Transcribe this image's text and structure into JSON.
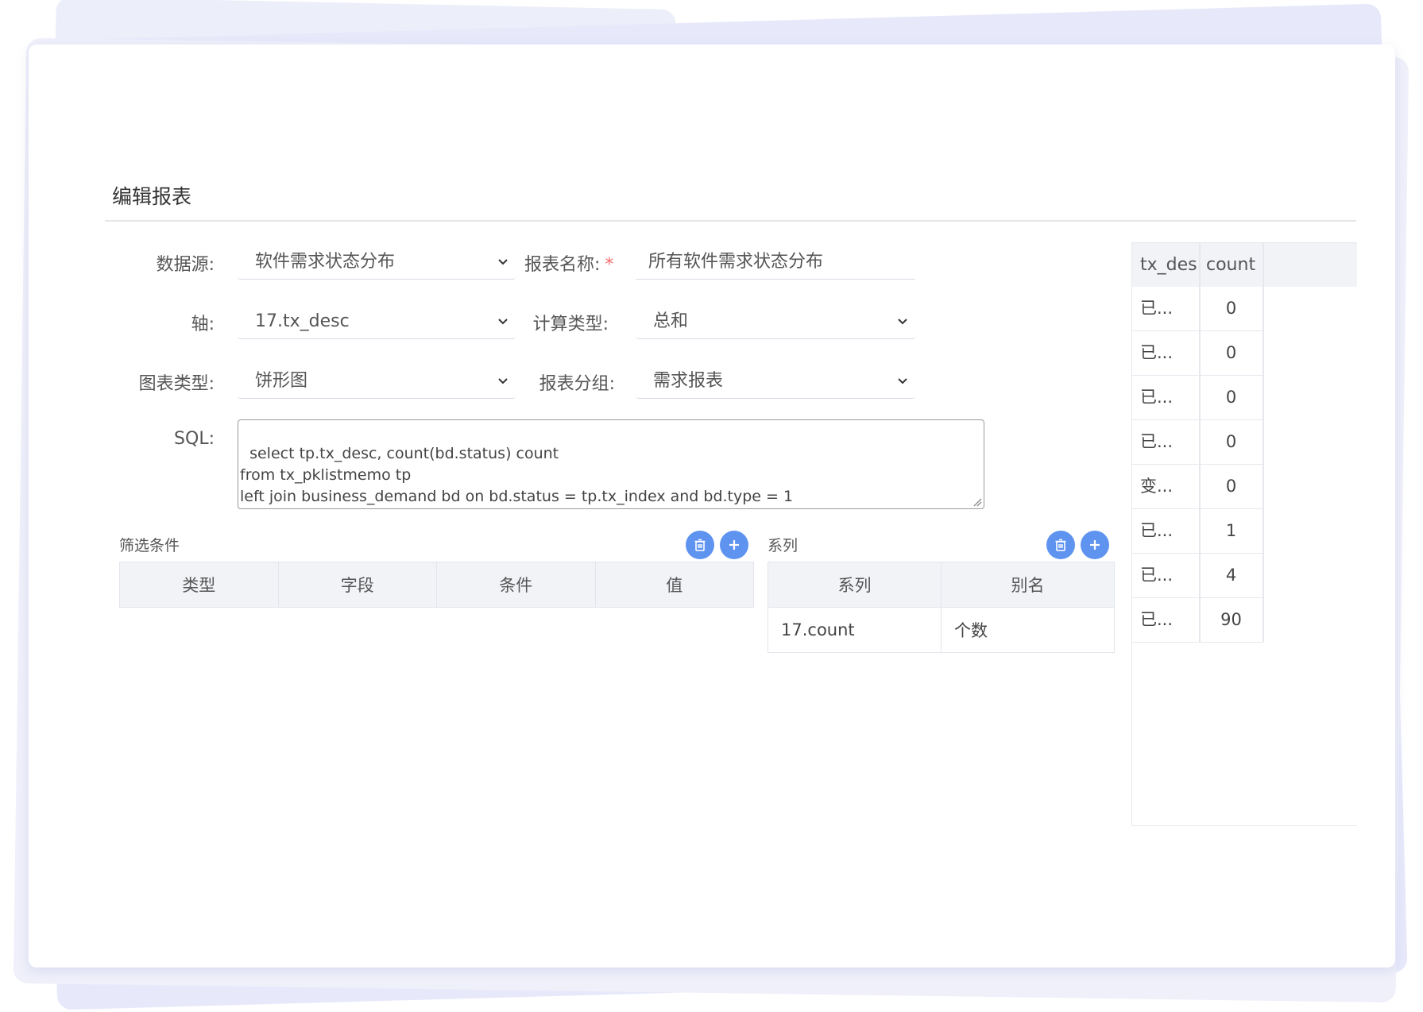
{
  "page": {
    "title": "编辑报表"
  },
  "form": {
    "datasource_label": "数据源:",
    "datasource_value": "软件需求状态分布",
    "report_name_label": "报表名称:",
    "report_name_required": "*",
    "report_name_value": "所有软件需求状态分布",
    "axis_label": "轴:",
    "axis_value": "17.tx_desc",
    "calc_type_label": "计算类型:",
    "calc_type_value": "总和",
    "chart_type_label": "图表类型:",
    "chart_type_value": "饼形图",
    "report_group_label": "报表分组:",
    "report_group_value": "需求报表",
    "sql_label": "SQL:",
    "sql_value": "select tp.tx_desc, count(bd.status) count\nfrom tx_pklistmemo tp\nleft join business_demand bd on bd.status = tp.tx_index and bd.type = 1\nwhere tp.plname = 'req_state' group BY tp.tx_desc order by count(bd.status)"
  },
  "filters": {
    "title": "筛选条件",
    "columns": [
      "类型",
      "字段",
      "条件",
      "值"
    ],
    "rows": []
  },
  "series": {
    "title": "系列",
    "columns": [
      "系列",
      "别名"
    ],
    "rows": [
      {
        "series": "17.count",
        "alias": "个数"
      }
    ]
  },
  "results": {
    "columns": [
      "tx_desc",
      "count"
    ],
    "rows": [
      {
        "tx_desc": "已...",
        "count": "0"
      },
      {
        "tx_desc": "已...",
        "count": "0"
      },
      {
        "tx_desc": "已...",
        "count": "0"
      },
      {
        "tx_desc": "已...",
        "count": "0"
      },
      {
        "tx_desc": "变...",
        "count": "0"
      },
      {
        "tx_desc": "已...",
        "count": "1"
      },
      {
        "tx_desc": "已...",
        "count": "4"
      },
      {
        "tx_desc": "已...",
        "count": "90"
      }
    ]
  },
  "icons": {
    "delete": "trash-icon",
    "add": "plus-icon",
    "dropdown": "chevron-down-icon"
  },
  "colors": {
    "accent": "#5e93f0",
    "required": "#f56c6c"
  }
}
